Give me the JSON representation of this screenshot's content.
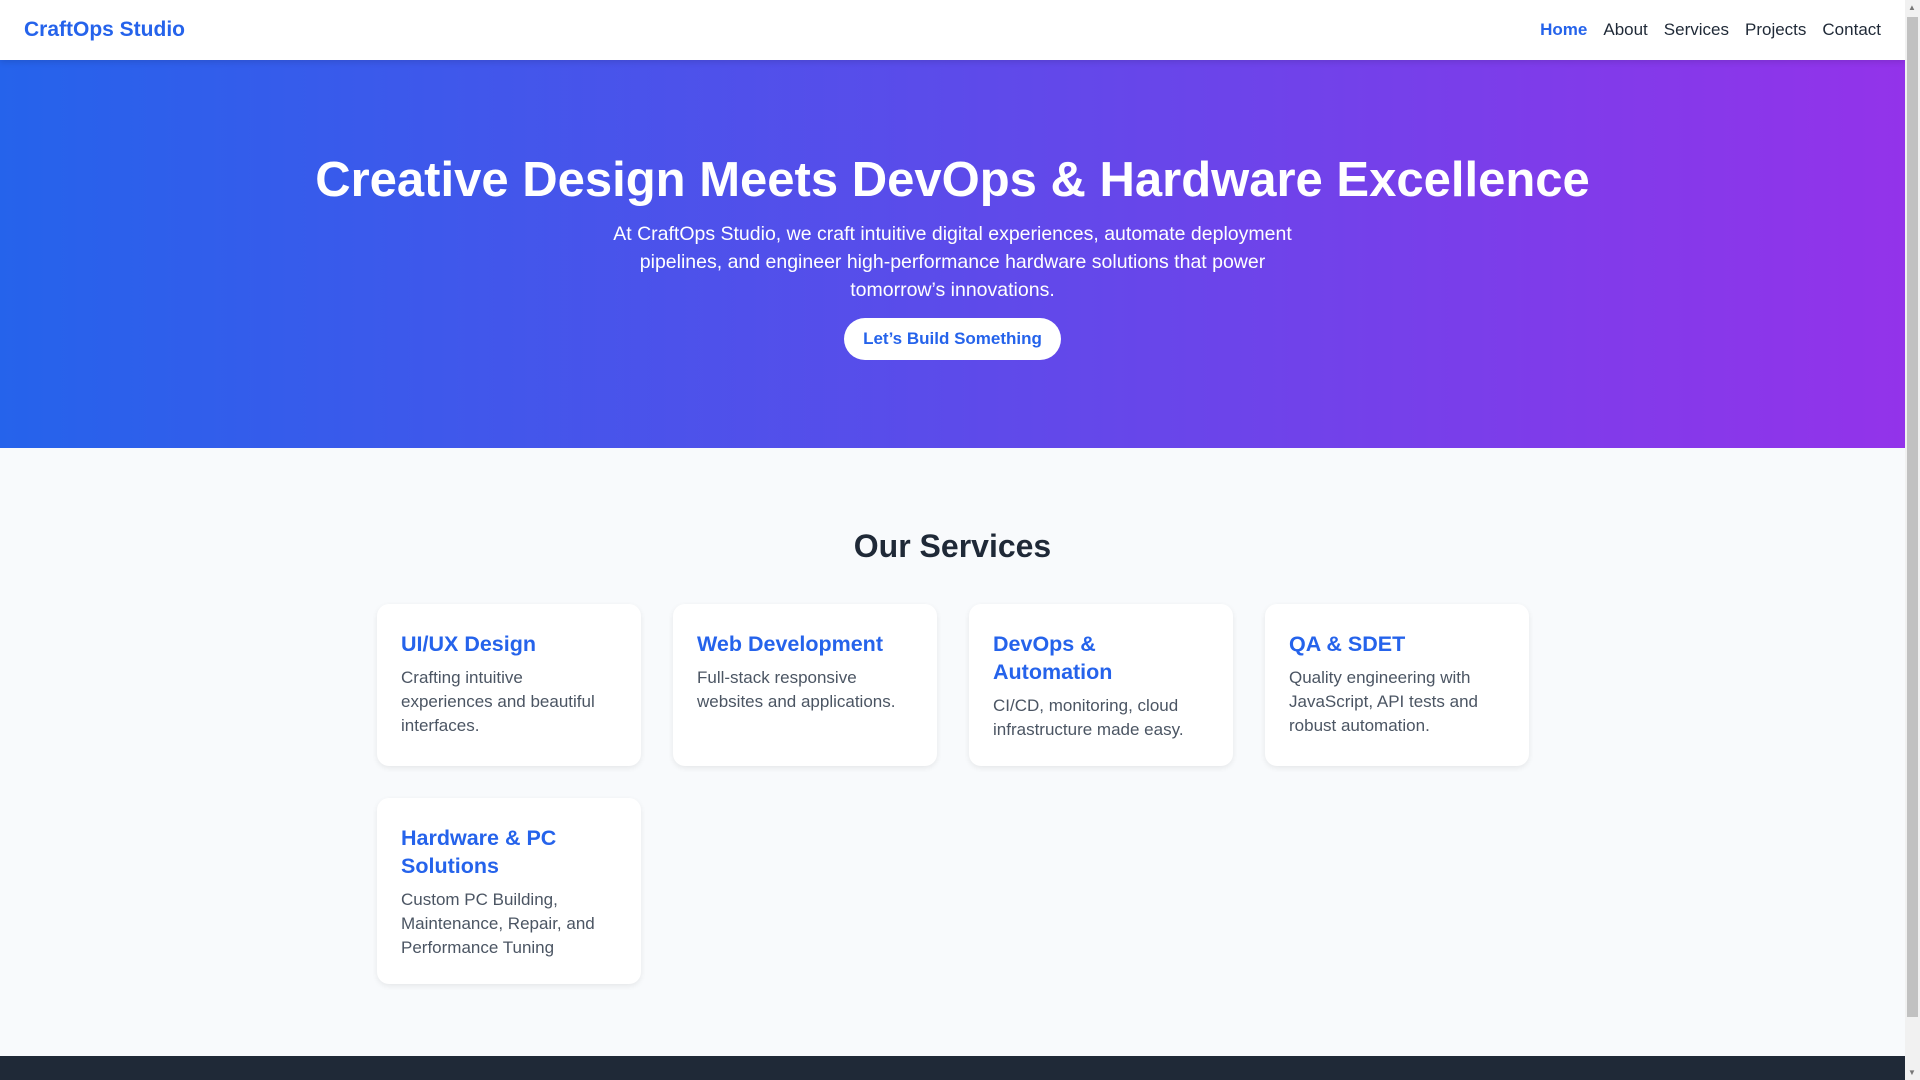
{
  "nav": {
    "logo": "CraftOps Studio",
    "links": [
      {
        "label": "Home"
      },
      {
        "label": "About"
      },
      {
        "label": "Services"
      },
      {
        "label": "Projects"
      },
      {
        "label": "Contact"
      }
    ]
  },
  "hero": {
    "title": "Creative Design Meets DevOps & Hardware Excellence",
    "subtitle": "At CraftOps Studio, we craft intuitive digital experiences, automate deployment pipelines, and engineer high-performance hardware solutions that power tomorrow’s innovations.",
    "cta": "Let’s Build Something"
  },
  "services": {
    "heading": "Our Services",
    "cards": [
      {
        "title": "UI/UX Design",
        "desc": "Crafting intuitive experiences and beautiful interfaces."
      },
      {
        "title": "Web Development",
        "desc": "Full-stack responsive websites and applications."
      },
      {
        "title": "DevOps & Automation",
        "desc": "CI/CD, monitoring, cloud infrastructure made easy."
      },
      {
        "title": "QA & SDET",
        "desc": "Quality engineering with JavaScript, API tests and robust automation."
      },
      {
        "title": "Hardware & PC Solutions",
        "desc": "Custom PC Building, Maintenance, Repair, and Performance Tuning"
      }
    ]
  },
  "colors": {
    "accent": "#2563eb",
    "gradient_end": "#9333ea",
    "footer": "#1f2937"
  }
}
